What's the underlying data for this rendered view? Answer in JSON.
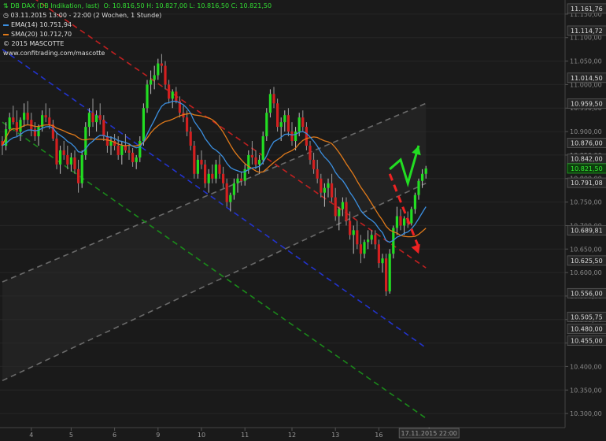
{
  "header": {
    "instrument": "DB DAX (DB Indikation, last)",
    "ohlc": "O: 10.816,50  H: 10.827,00  L: 10.816,50  C: 10.821,50",
    "range": "03.11.2015 13:00 - 22:00 (2 Wochen, 1 Stunde)",
    "ema_label": "EMA(14)  10.751,94",
    "sma_label": "SMA(20)  10.712,70",
    "copyright": "© 2015 MASCOTTE",
    "url": "www.confitrading.com/mascotte"
  },
  "colors": {
    "background": "#1a1a1a",
    "up": "#22dd22",
    "down": "#d32020",
    "ema": "#3b8fe0",
    "sma": "#e07a1a",
    "channel_red": "#c02020",
    "channel_blue": "#2233cc",
    "channel_green": "#1a8a1a",
    "channel_gray": "#6a6a6a",
    "arrow_up": "#22dd22",
    "arrow_down": "#ee2222"
  },
  "chart_data": {
    "type": "candlestick",
    "title": "DB DAX (DB Indikation, last)",
    "interval": "1 Stunde",
    "x_ticks": [
      "4",
      "5",
      "6",
      "9",
      "10",
      "11",
      "12",
      "13",
      "16"
    ],
    "crosshair_x_label": "17.11.2015 22:00",
    "ylim": [
      10270,
      11180
    ],
    "y_ticks": [
      "11.150,00",
      "11.100,00",
      "11.050,00",
      "11.000,00",
      "10.950,00",
      "10.900,00",
      "10.850,00",
      "10.800,00",
      "10.750,00",
      "10.700,00",
      "10.650,00",
      "10.600,00",
      "10.550,00",
      "10.500,00",
      "10.450,00",
      "10.400,00",
      "10.350,00",
      "10.300,00"
    ],
    "y_tick_values": [
      11150,
      11100,
      11050,
      11000,
      10950,
      10900,
      10850,
      10800,
      10750,
      10700,
      10650,
      10600,
      10550,
      10500,
      10450,
      10400,
      10350,
      10300
    ],
    "price_labels": [
      {
        "value": 11161.76,
        "text": "11.161,76",
        "style": "dark"
      },
      {
        "value": 11114.72,
        "text": "11.114,72",
        "style": "dark"
      },
      {
        "value": 11014.5,
        "text": "11.014,50",
        "style": "dark"
      },
      {
        "value": 10959.5,
        "text": "10.959,50",
        "style": "dark"
      },
      {
        "value": 10876.0,
        "text": "10.876,00",
        "style": "dark"
      },
      {
        "value": 10842.0,
        "text": "10.842,00",
        "style": "dark"
      },
      {
        "value": 10821.5,
        "text": "10.821,50",
        "style": "green"
      },
      {
        "value": 10791.08,
        "text": "10.791,08",
        "style": "dark"
      },
      {
        "value": 10689.81,
        "text": "10.689,81",
        "style": "dark"
      },
      {
        "value": 10625.5,
        "text": "10.625,50",
        "style": "dark"
      },
      {
        "value": 10556.0,
        "text": "10.556,00",
        "style": "dark"
      },
      {
        "value": 10505.75,
        "text": "10.505,75",
        "style": "dark"
      },
      {
        "value": 10480.0,
        "text": "10.480,00",
        "style": "dark"
      },
      {
        "value": 10455.0,
        "text": "10.455,00",
        "style": "dark"
      }
    ],
    "candles": [
      [
        10880,
        10890,
        10850,
        10870
      ],
      [
        10870,
        10920,
        10860,
        10905
      ],
      [
        10905,
        10940,
        10900,
        10930
      ],
      [
        10930,
        10955,
        10915,
        10920
      ],
      [
        10920,
        10945,
        10890,
        10900
      ],
      [
        10900,
        10930,
        10880,
        10925
      ],
      [
        10925,
        10960,
        10910,
        10940
      ],
      [
        10940,
        10965,
        10915,
        10925
      ],
      [
        10925,
        10940,
        10890,
        10905
      ],
      [
        10905,
        10920,
        10880,
        10890
      ],
      [
        10890,
        10915,
        10870,
        10910
      ],
      [
        10910,
        10945,
        10900,
        10935
      ],
      [
        10935,
        10960,
        10920,
        10930
      ],
      [
        10930,
        10950,
        10905,
        10915
      ],
      [
        10915,
        10925,
        10880,
        10885
      ],
      [
        10885,
        10900,
        10820,
        10830
      ],
      [
        10830,
        10870,
        10810,
        10860
      ],
      [
        10860,
        10880,
        10840,
        10850
      ],
      [
        10850,
        10870,
        10820,
        10830
      ],
      [
        10830,
        10855,
        10815,
        10845
      ],
      [
        10845,
        10860,
        10810,
        10820
      ],
      [
        10820,
        10840,
        10770,
        10790
      ],
      [
        10790,
        10860,
        10780,
        10850
      ],
      [
        10850,
        10920,
        10840,
        10910
      ],
      [
        10910,
        10950,
        10890,
        10940
      ],
      [
        10940,
        10970,
        10910,
        10920
      ],
      [
        10920,
        10945,
        10900,
        10935
      ],
      [
        10935,
        10960,
        10915,
        10925
      ],
      [
        10925,
        10935,
        10880,
        10890
      ],
      [
        10890,
        10900,
        10855,
        10870
      ],
      [
        10870,
        10890,
        10850,
        10880
      ],
      [
        10880,
        10895,
        10860,
        10870
      ],
      [
        10870,
        10890,
        10840,
        10850
      ],
      [
        10850,
        10880,
        10830,
        10870
      ],
      [
        10870,
        10895,
        10855,
        10860
      ],
      [
        10860,
        10875,
        10840,
        10855
      ],
      [
        10855,
        10865,
        10825,
        10835
      ],
      [
        10835,
        10850,
        10820,
        10845
      ],
      [
        10845,
        10890,
        10835,
        10880
      ],
      [
        10880,
        10960,
        10870,
        10950
      ],
      [
        10950,
        11010,
        10940,
        11000
      ],
      [
        11000,
        11030,
        10980,
        11010
      ],
      [
        11010,
        11040,
        10990,
        11020
      ],
      [
        11020,
        11055,
        11010,
        11045
      ],
      [
        11045,
        11065,
        11025,
        11040
      ],
      [
        11040,
        11050,
        10990,
        11000
      ],
      [
        11000,
        11010,
        10960,
        10970
      ],
      [
        10970,
        10990,
        10950,
        10985
      ],
      [
        10985,
        10995,
        10960,
        10965
      ],
      [
        10965,
        10975,
        10930,
        10940
      ],
      [
        10940,
        10955,
        10920,
        10930
      ],
      [
        10930,
        10945,
        10890,
        10900
      ],
      [
        10900,
        10910,
        10860,
        10870
      ],
      [
        10870,
        10880,
        10800,
        10810
      ],
      [
        10810,
        10850,
        10800,
        10840
      ],
      [
        10840,
        10860,
        10820,
        10830
      ],
      [
        10830,
        10840,
        10780,
        10790
      ],
      [
        10790,
        10820,
        10770,
        10810
      ],
      [
        10810,
        10830,
        10790,
        10800
      ],
      [
        10800,
        10840,
        10790,
        10830
      ],
      [
        10830,
        10850,
        10800,
        10810
      ],
      [
        10810,
        10825,
        10780,
        10790
      ],
      [
        10790,
        10800,
        10740,
        10750
      ],
      [
        10750,
        10770,
        10730,
        10765
      ],
      [
        10765,
        10800,
        10755,
        10790
      ],
      [
        10790,
        10810,
        10770,
        10800
      ],
      [
        10800,
        10815,
        10785,
        10795
      ],
      [
        10795,
        10830,
        10785,
        10820
      ],
      [
        10820,
        10860,
        10810,
        10850
      ],
      [
        10850,
        10880,
        10830,
        10845
      ],
      [
        10845,
        10860,
        10820,
        10830
      ],
      [
        10830,
        10850,
        10810,
        10840
      ],
      [
        10840,
        10900,
        10830,
        10890
      ],
      [
        10890,
        10950,
        10880,
        10940
      ],
      [
        10940,
        10990,
        10930,
        10980
      ],
      [
        10980,
        10995,
        10950,
        10960
      ],
      [
        10960,
        10970,
        10900,
        10910
      ],
      [
        10910,
        10930,
        10880,
        10920
      ],
      [
        10920,
        10945,
        10900,
        10935
      ],
      [
        10935,
        10950,
        10890,
        10900
      ],
      [
        10900,
        10920,
        10870,
        10880
      ],
      [
        10880,
        10910,
        10860,
        10900
      ],
      [
        10900,
        10940,
        10890,
        10930
      ],
      [
        10930,
        10945,
        10900,
        10910
      ],
      [
        10910,
        10920,
        10860,
        10870
      ],
      [
        10870,
        10880,
        10830,
        10840
      ],
      [
        10840,
        10855,
        10810,
        10820
      ],
      [
        10820,
        10840,
        10790,
        10800
      ],
      [
        10800,
        10810,
        10760,
        10770
      ],
      [
        10770,
        10790,
        10740,
        10780
      ],
      [
        10780,
        10800,
        10760,
        10790
      ],
      [
        10790,
        10810,
        10750,
        10760
      ],
      [
        10760,
        10780,
        10710,
        10720
      ],
      [
        10720,
        10740,
        10690,
        10735
      ],
      [
        10735,
        10760,
        10720,
        10750
      ],
      [
        10750,
        10760,
        10700,
        10710
      ],
      [
        10710,
        10730,
        10670,
        10680
      ],
      [
        10680,
        10700,
        10640,
        10690
      ],
      [
        10690,
        10710,
        10650,
        10660
      ],
      [
        10660,
        10680,
        10620,
        10640
      ],
      [
        10640,
        10670,
        10630,
        10665
      ],
      [
        10665,
        10690,
        10650,
        10670
      ],
      [
        10670,
        10690,
        10660,
        10680
      ],
      [
        10680,
        10690,
        10650,
        10660
      ],
      [
        10660,
        10670,
        10610,
        10620
      ],
      [
        10620,
        10640,
        10600,
        10630
      ],
      [
        10630,
        10640,
        10550,
        10560
      ],
      [
        10560,
        10650,
        10555,
        10640
      ],
      [
        10640,
        10700,
        10630,
        10695
      ],
      [
        10695,
        10740,
        10680,
        10720
      ],
      [
        10720,
        10735,
        10690,
        10700
      ],
      [
        10700,
        10720,
        10680,
        10715
      ],
      [
        10715,
        10730,
        10695,
        10705
      ],
      [
        10705,
        10740,
        10700,
        10735
      ],
      [
        10735,
        10770,
        10725,
        10765
      ],
      [
        10765,
        10800,
        10755,
        10795
      ],
      [
        10795,
        10820,
        10780,
        10810
      ],
      [
        10810,
        10827,
        10800,
        10821.5
      ]
    ],
    "ema14_value": 10751.94,
    "sma20_value": 10712.7,
    "channels": {
      "red_dashed": [
        [
          0,
          11230
        ],
        [
          117,
          10610
        ]
      ],
      "blue_dashed": [
        [
          0,
          11075
        ],
        [
          117,
          10440
        ]
      ],
      "green_dashed": [
        [
          0,
          10920
        ],
        [
          117,
          10290
        ]
      ],
      "gray_upper": [
        [
          0,
          10580
        ],
        [
          117,
          10960
        ]
      ],
      "gray_lower": [
        [
          0,
          10370
        ],
        [
          117,
          10790
        ]
      ]
    },
    "arrows": {
      "up_path": [
        [
          107,
          10820
        ],
        [
          110,
          10840
        ],
        [
          112,
          10790
        ],
        [
          115,
          10870
        ]
      ],
      "down_path": [
        [
          107,
          10810
        ],
        [
          115,
          10640
        ]
      ]
    }
  }
}
